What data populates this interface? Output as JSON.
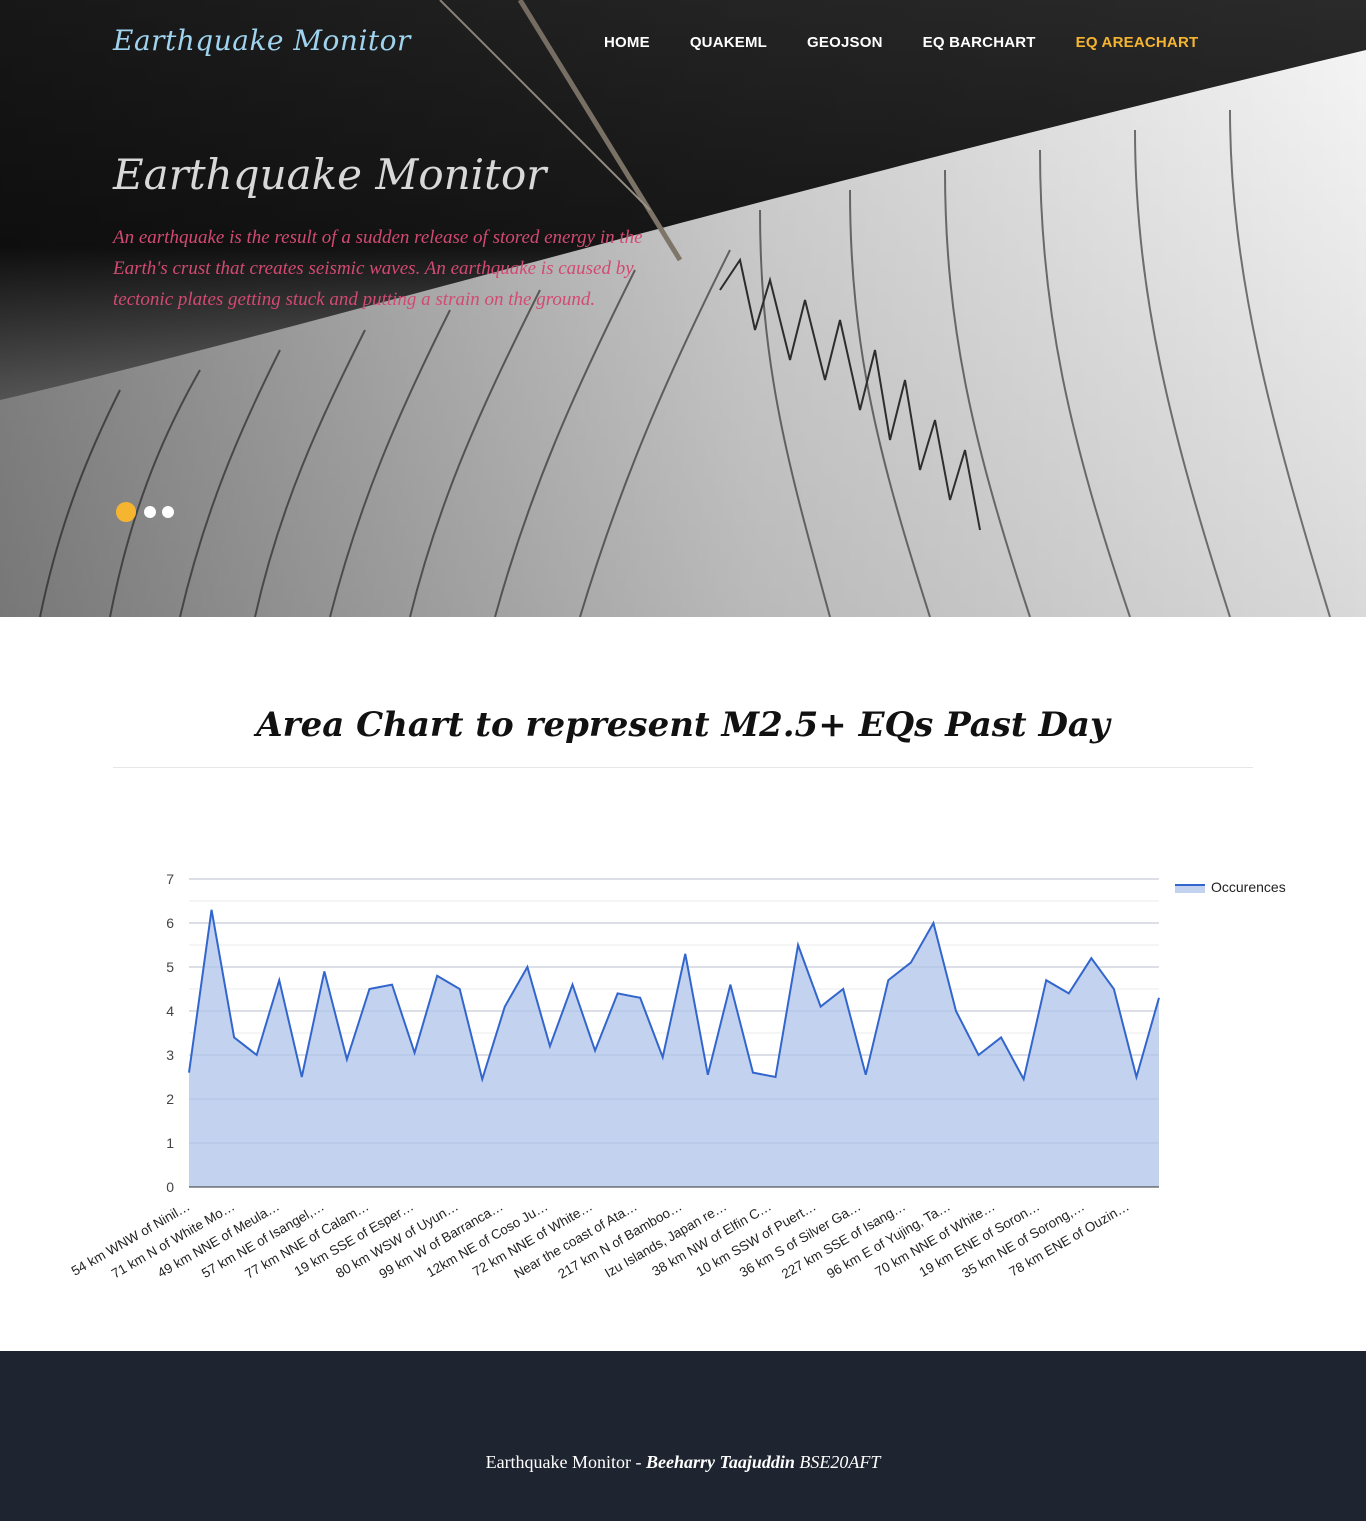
{
  "brand": "Earthquake Monitor",
  "nav": [
    {
      "label": "HOME",
      "active": false
    },
    {
      "label": "QUAKEML",
      "active": false
    },
    {
      "label": "GEOJSON",
      "active": false
    },
    {
      "label": "EQ BARCHART",
      "active": false
    },
    {
      "label": "EQ AREACHART",
      "active": true
    }
  ],
  "hero": {
    "title": "Earthquake Monitor",
    "text": "An earthquake is the result of a sudden release of stored energy in the Earth's crust that creates seismic waves. An earthquake is caused by tectonic plates getting stuck and putting a strain on the ground.",
    "slides": 3,
    "active_slide": 0
  },
  "section": {
    "heading": "Area Chart to represent M2.5+ EQs Past Day"
  },
  "chart_data": {
    "type": "area",
    "title": "",
    "xlabel": "",
    "ylabel": "",
    "ylim": [
      0,
      7
    ],
    "yticks": [
      0,
      1,
      2,
      3,
      4,
      5,
      6,
      7
    ],
    "grid": true,
    "legend": "right",
    "series": [
      {
        "name": "Occurences",
        "values": [
          2.6,
          6.3,
          3.4,
          3.0,
          4.7,
          2.5,
          4.9,
          2.9,
          4.5,
          4.6,
          3.05,
          4.8,
          4.5,
          2.45,
          4.1,
          5.0,
          3.2,
          4.6,
          3.1,
          4.4,
          4.3,
          2.95,
          5.3,
          2.55,
          4.6,
          2.6,
          2.5,
          5.5,
          4.1,
          4.5,
          2.55,
          4.7,
          5.1,
          6.0,
          4.0,
          3.0,
          3.4,
          2.45,
          4.7,
          4.4,
          5.2,
          4.5,
          2.5,
          4.3
        ]
      }
    ],
    "category_labels": [
      "54 km WNW of Ninil…",
      "71 km N of White Mo…",
      "49 km NNE of Meula…",
      "57 km NE of Isangel,…",
      "77 km NNE of Calam…",
      "19 km SSE of Esper…",
      "80 km WSW of Uyun…",
      "99 km W of Barranca…",
      "12km NE of Coso Ju…",
      "72 km NNE of White…",
      "Near the coast of Ata…",
      "217 km N of Bamboo…",
      "Izu Islands, Japan re…",
      "38 km NW of Elfin C…",
      "10 km SSW of Puert…",
      "36 km S of Silver Ga…",
      "227 km SSE of Isang…",
      "96 km E of Yujing, Ta…",
      "70 km NNE of White…",
      "19 km ENE of Soron…",
      "35 km NE of Sorong,…",
      "78 km ENE of Ouzin…"
    ],
    "colors": {
      "line": "#3366cc",
      "fill": "#c2d2ef"
    }
  },
  "footer": {
    "prefix": "Earthquake Monitor - ",
    "author": "Beeharry Taajuddin",
    "code": "BSE20AFT"
  }
}
